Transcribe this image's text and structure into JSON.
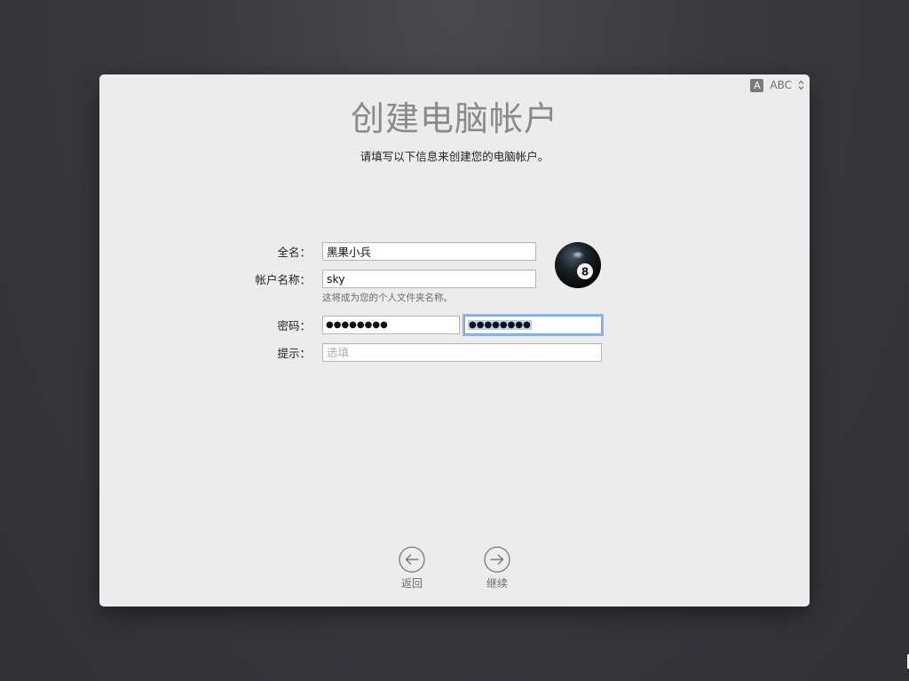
{
  "input_menu": {
    "badge": "A",
    "source": "ABC"
  },
  "header": {
    "title": "创建电脑帐户",
    "subtitle": "请填写以下信息来创建您的电脑帐户。"
  },
  "form": {
    "full_name": {
      "label": "全名：",
      "value": "黑果小兵"
    },
    "account_name": {
      "label": "帐户名称：",
      "value": "sky",
      "hint": "这将成为您的个人文件夹名称。"
    },
    "password": {
      "label": "密码：",
      "value": "●●●●●●●●",
      "verify_value": "●●●●●●●●"
    },
    "hint": {
      "label": "提示：",
      "value": "",
      "placeholder": "选填"
    }
  },
  "avatar": {
    "icon": "eight-ball",
    "number": "8"
  },
  "navigation": {
    "back_label": "返回",
    "continue_label": "继续"
  }
}
